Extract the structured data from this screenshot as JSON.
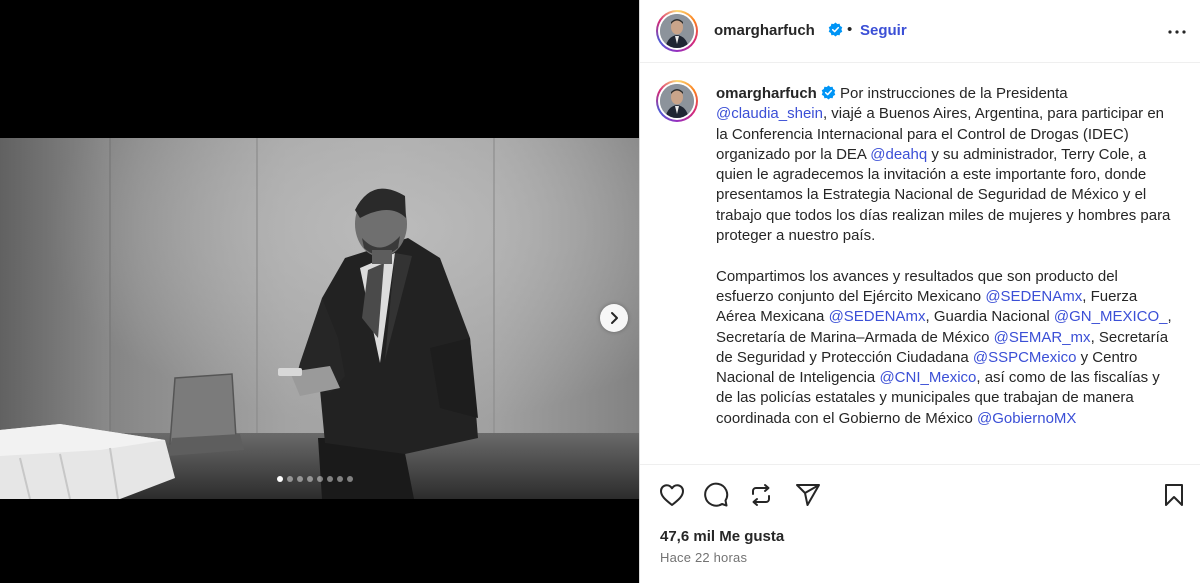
{
  "post": {
    "username": "omargharfuch",
    "verified": true,
    "separator": "•",
    "follow_label": "Seguir",
    "more_icon": "more-horizontal-icon"
  },
  "carousel": {
    "slide_count": 8,
    "active_index": 0,
    "next_icon": "chevron-right-icon"
  },
  "caption": {
    "username": "omargharfuch",
    "paragraphs": [
      [
        {
          "t": "text",
          "v": " Por instrucciones de la Presidenta "
        },
        {
          "t": "mention",
          "v": "@claudia_shein"
        },
        {
          "t": "text",
          "v": ", viajé a Buenos Aires, Argentina, para participar en la Conferencia Internacional para el Control de Drogas (IDEC) organizado por la DEA "
        },
        {
          "t": "mention",
          "v": "@deahq"
        },
        {
          "t": "text",
          "v": " y su administrador, Terry Cole, a quien le agradecemos la invitación a este importante foro, donde presentamos la Estrategia Nacional de Seguridad de México y el trabajo que todos los días realizan miles de mujeres y hombres para proteger a nuestro país."
        }
      ],
      [
        {
          "t": "text",
          "v": "Compartimos los avances y resultados que son producto del esfuerzo conjunto del Ejército Mexicano "
        },
        {
          "t": "mention",
          "v": "@SEDENAmx"
        },
        {
          "t": "text",
          "v": ", Fuerza Aérea Mexicana "
        },
        {
          "t": "mention",
          "v": "@SEDENAmx"
        },
        {
          "t": "text",
          "v": ", Guardia Nacional "
        },
        {
          "t": "mention",
          "v": "@GN_MEXICO_"
        },
        {
          "t": "text",
          "v": ", Secretaría de Marina–Armada de México "
        },
        {
          "t": "mention",
          "v": "@SEMAR_mx"
        },
        {
          "t": "text",
          "v": ", Secretaría de Seguridad y Protección Ciudadana "
        },
        {
          "t": "mention",
          "v": "@SSPCMexico"
        },
        {
          "t": "text",
          "v": " y Centro Nacional de Inteligencia "
        },
        {
          "t": "mention",
          "v": "@CNI_Mexico"
        },
        {
          "t": "text",
          "v": ", así como de las fiscalías y de las policías estatales y municipales que trabajan de manera coordinada con el Gobierno de México "
        },
        {
          "t": "mention",
          "v": "@GobiernoMX"
        }
      ]
    ]
  },
  "actions": {
    "like_icon": "heart-icon",
    "comment_icon": "comment-icon",
    "repost_icon": "repost-icon",
    "share_icon": "send-icon",
    "save_icon": "bookmark-icon"
  },
  "stats": {
    "likes": "47,6 mil Me gusta",
    "time": "Hace 22 horas"
  },
  "colors": {
    "link": "#3b4fd6",
    "verified": "#0095f6",
    "text": "#262626",
    "muted": "#737373"
  }
}
